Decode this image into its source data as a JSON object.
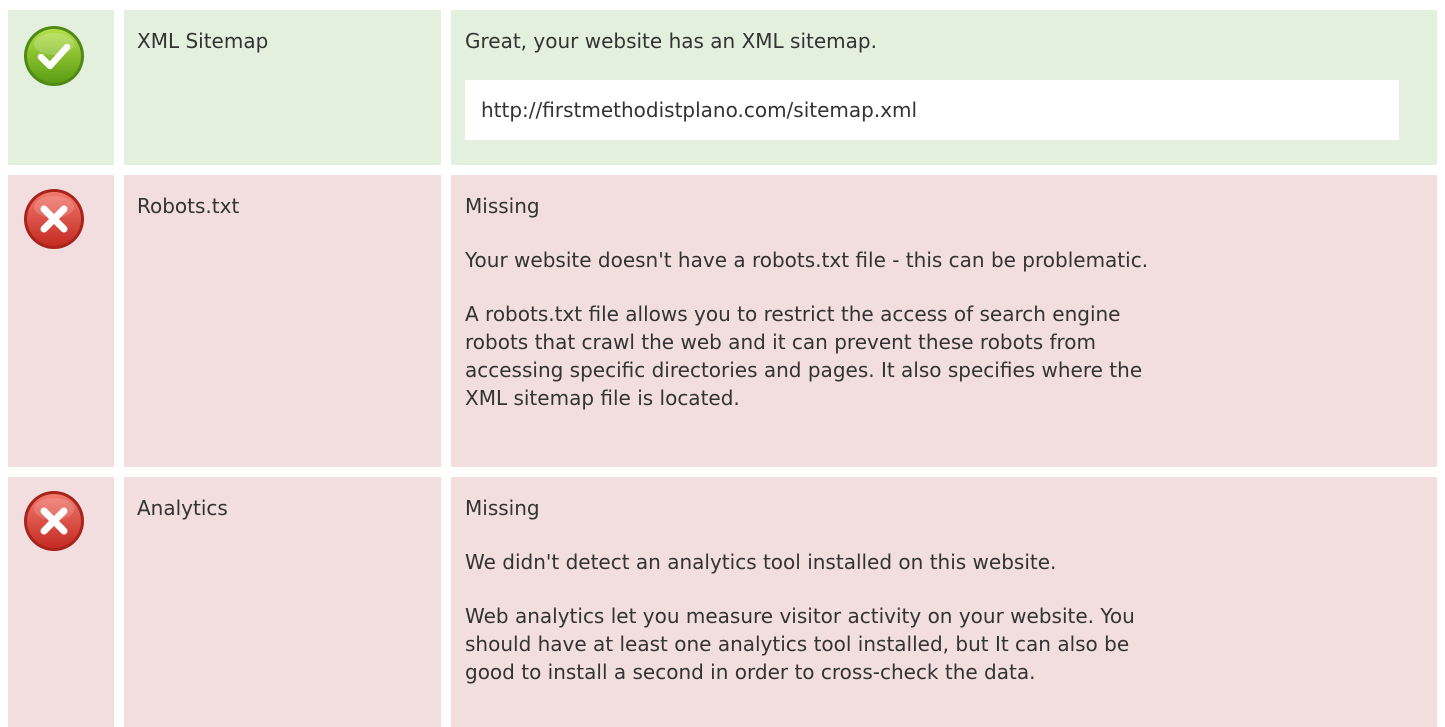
{
  "checks": [
    {
      "status": "pass",
      "icon": "check-circle-icon",
      "label": "XML Sitemap",
      "headline": "Great, your website has an XML sitemap.",
      "url": "http://firstmethodistplano.com/sitemap.xml"
    },
    {
      "status": "fail",
      "icon": "error-circle-icon",
      "label": "Robots.txt",
      "headline": "Missing",
      "summary": "Your website doesn't have a robots.txt file - this can be problematic.",
      "detail_lines": [
        "A robots.txt file allows you to restrict the access of search engine",
        "robots that crawl the web and it can prevent these robots from",
        "accessing specific directories and pages. It also specifies where the",
        "XML sitemap file is located."
      ]
    },
    {
      "status": "fail",
      "icon": "error-circle-icon",
      "label": "Analytics",
      "headline": "Missing",
      "summary": "We didn't detect an analytics tool installed on this website.",
      "detail_lines": [
        "Web analytics let you measure visitor activity on your website. You",
        "should have at least one analytics tool installed, but It can also be",
        "good to install a second in order to cross-check the data."
      ]
    }
  ],
  "colors": {
    "pass_bg": "#e3f0de",
    "fail_bg": "#f2dedf",
    "pass_icon": "#6fae1c",
    "fail_icon": "#d83a32"
  }
}
